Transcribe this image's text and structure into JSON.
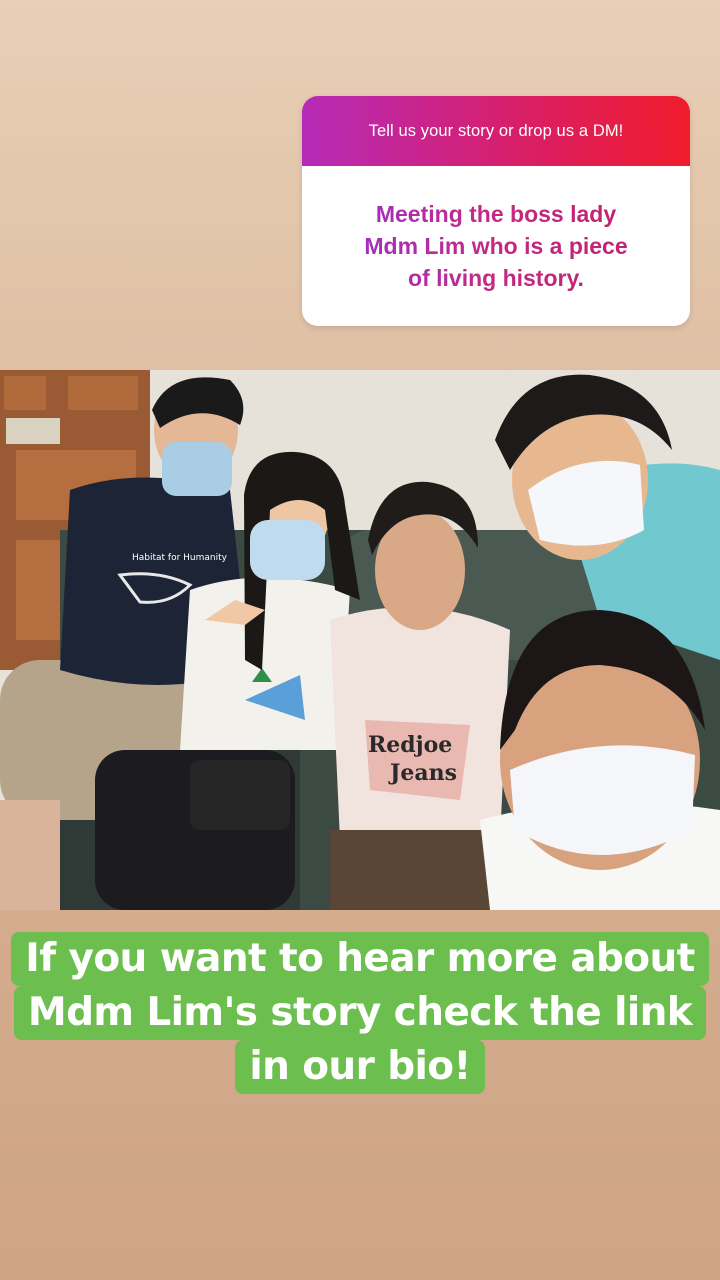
{
  "sticker": {
    "prompt": "Tell us your story or drop us a DM!",
    "answer_lines": [
      "Meeting the boss lady",
      "Mdm Lim who is a piece",
      "of living history."
    ]
  },
  "photo": {
    "shirt_texts": {
      "habitat": "Habitat for Humanity",
      "redjoe": "Redjoe",
      "jeans": "Jeans"
    }
  },
  "caption": {
    "lines": [
      "If you want to hear more about",
      "Mdm Lim's story check the link",
      "in our bio!"
    ]
  },
  "colors": {
    "background_top": "#e8cfb6",
    "background_bottom": "#cfa386",
    "sticker_gradient_start": "#b52bb8",
    "sticker_gradient_end": "#f01c2a",
    "caption_bg": "#6cbf4f"
  }
}
